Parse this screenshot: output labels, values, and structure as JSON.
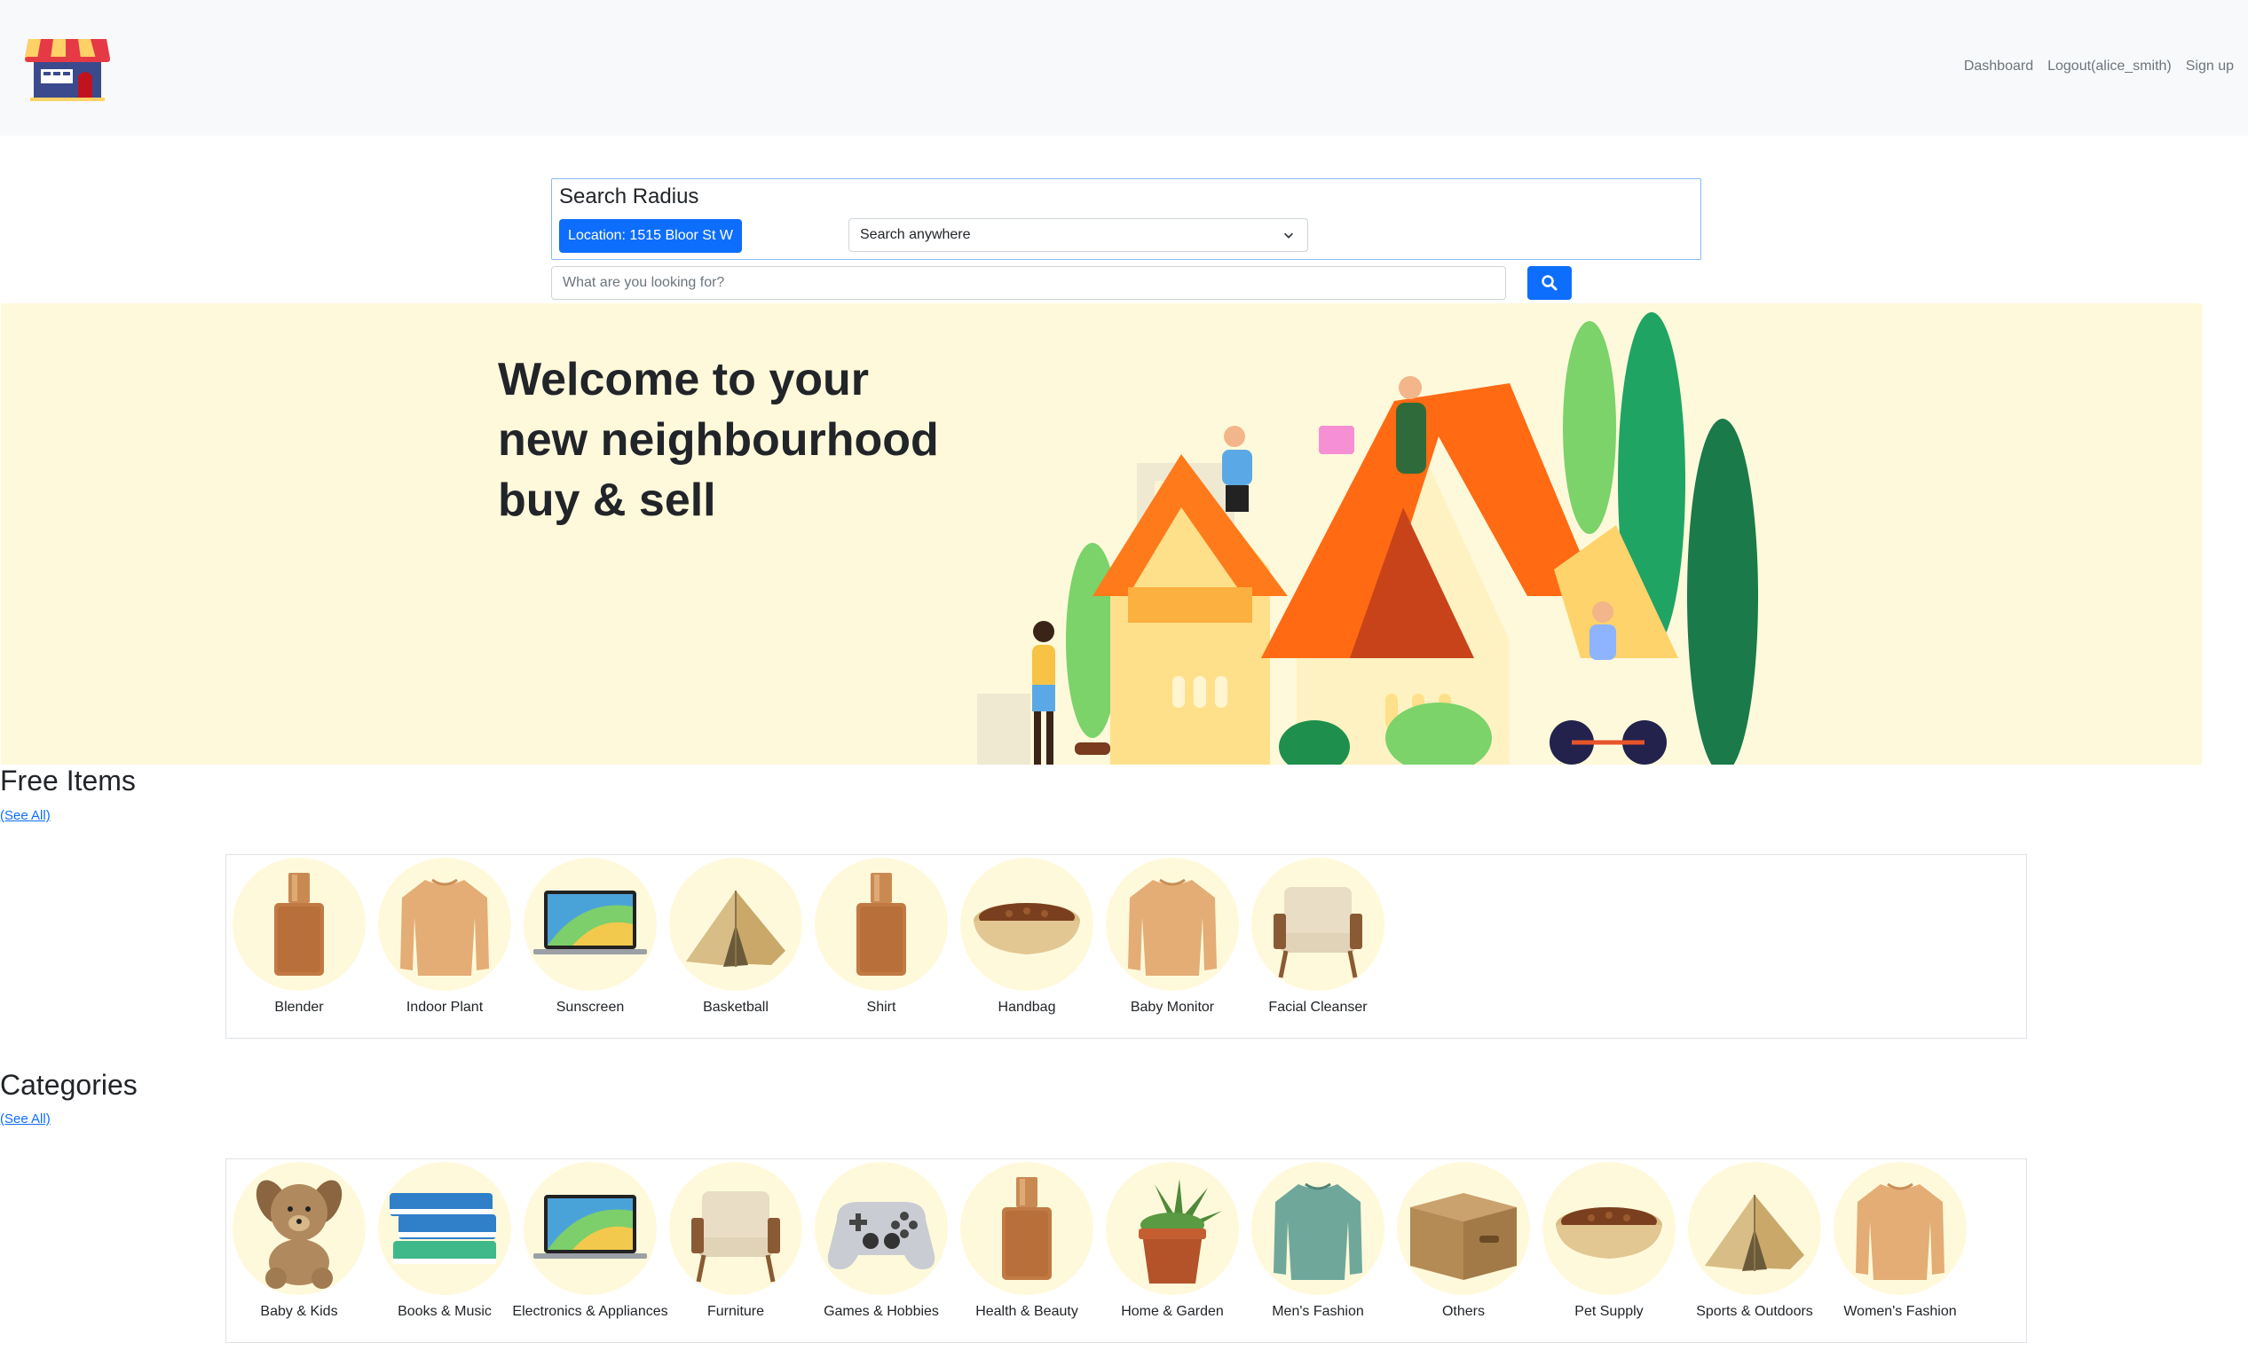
{
  "nav": {
    "dashboard": "Dashboard",
    "logout": "Logout(alice_smith)",
    "signup": "Sign up"
  },
  "search": {
    "radius_title": "Search Radius",
    "location_button": "Location: 1515 Bloor St W",
    "radius_selected": "Search anywhere",
    "query_placeholder": "What are you looking for?"
  },
  "hero": {
    "line1": "Welcome to your",
    "line2": "new neighbourhood",
    "line3": "buy & sell"
  },
  "free_items": {
    "title": "Free Items",
    "see_all": "(See All)",
    "items": [
      {
        "label": "Blender",
        "icon": "foundation-bottle-icon"
      },
      {
        "label": "Indoor Plant",
        "icon": "sweater-icon"
      },
      {
        "label": "Sunscreen",
        "icon": "laptop-icon"
      },
      {
        "label": "Basketball",
        "icon": "tent-icon"
      },
      {
        "label": "Shirt",
        "icon": "foundation-bottle-icon"
      },
      {
        "label": "Handbag",
        "icon": "pet-bowl-icon"
      },
      {
        "label": "Baby Monitor",
        "icon": "sweater-icon"
      },
      {
        "label": "Facial Cleanser",
        "icon": "armchair-icon"
      }
    ]
  },
  "categories": {
    "title": "Categories",
    "see_all": "(See All)",
    "items": [
      {
        "label": "Baby & Kids",
        "icon": "teddy-bear-icon"
      },
      {
        "label": "Books & Music",
        "icon": "books-icon"
      },
      {
        "label": "Electronics & Appliances",
        "icon": "laptop-icon"
      },
      {
        "label": "Furniture",
        "icon": "armchair-icon"
      },
      {
        "label": "Games & Hobbies",
        "icon": "game-controller-icon"
      },
      {
        "label": "Health & Beauty",
        "icon": "foundation-bottle-icon"
      },
      {
        "label": "Home & Garden",
        "icon": "potted-plant-icon"
      },
      {
        "label": "Men's Fashion",
        "icon": "green-sweater-icon"
      },
      {
        "label": "Others",
        "icon": "cardboard-box-icon"
      },
      {
        "label": "Pet Supply",
        "icon": "pet-bowl-icon"
      },
      {
        "label": "Sports & Outdoors",
        "icon": "tent-icon"
      },
      {
        "label": "Women's Fashion",
        "icon": "sweater-icon"
      }
    ]
  },
  "colors": {
    "primary": "#0d6efd",
    "navbar_bg": "#f8f9fa",
    "hero_bg": "#fff9db",
    "thumb_bg": "#fff9db"
  }
}
